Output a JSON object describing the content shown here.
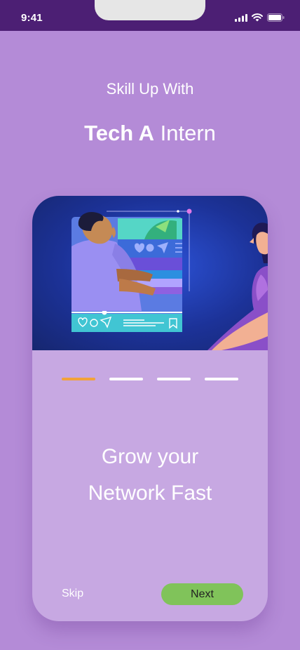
{
  "status_bar": {
    "time": "9:41",
    "icons": [
      "cellular-signal-icon",
      "wifi-icon",
      "battery-icon"
    ]
  },
  "header": {
    "subtitle": "Skill Up With",
    "brand_bold": "Tech A",
    "brand_light": " Intern"
  },
  "onboarding": {
    "illustration": "person-using-social-media-illustration",
    "pager": {
      "total": 4,
      "active_index": 0
    },
    "headline_line1": "Grow your",
    "headline_line2": "Network Fast",
    "skip_label": "Skip",
    "next_label": "Next"
  },
  "colors": {
    "background": "#b48bd7",
    "status_bar": "#4c1f74",
    "card": "#c7a8e2",
    "pager_active": "#f2a23a",
    "pager_inactive": "#ffffff",
    "next_button": "#80c35a"
  }
}
